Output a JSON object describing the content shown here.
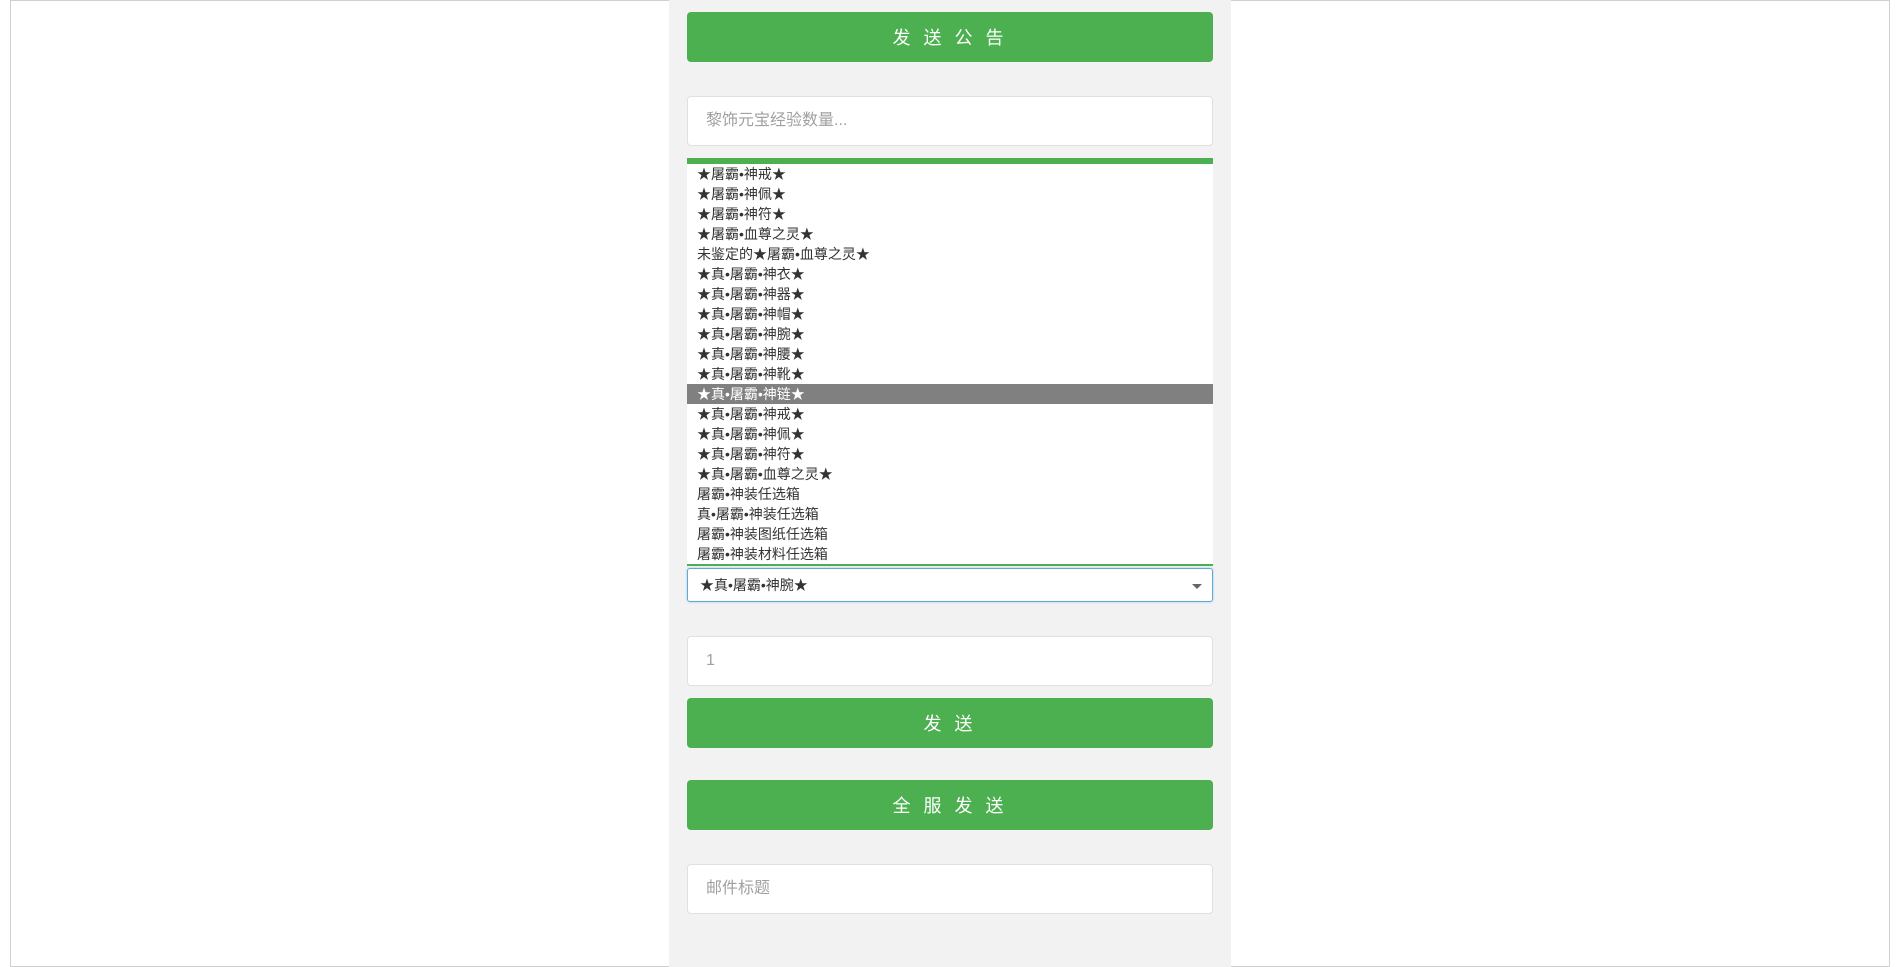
{
  "buttons": {
    "send_notice": "发 送 公 告",
    "send": "发 送",
    "send_all": "全 服 发 送"
  },
  "inputs": {
    "quantity_placeholder": "黎饰元宝经验数量...",
    "count_placeholder": "1",
    "mail_title_placeholder": "邮件标题"
  },
  "select": {
    "selected_value": "★真•屠霸•神腕★",
    "highlighted_index": 11,
    "options": [
      "★屠霸•神戒★",
      "★屠霸•神佩★",
      "★屠霸•神符★",
      "★屠霸•血尊之灵★",
      "未鉴定的★屠霸•血尊之灵★",
      "★真•屠霸•神衣★",
      "★真•屠霸•神器★",
      "★真•屠霸•神帽★",
      "★真•屠霸•神腕★",
      "★真•屠霸•神腰★",
      "★真•屠霸•神靴★",
      "★真•屠霸•神链★",
      "★真•屠霸•神戒★",
      "★真•屠霸•神佩★",
      "★真•屠霸•神符★",
      "★真•屠霸•血尊之灵★",
      "屠霸•神装任选箱",
      "真•屠霸•神装任选箱",
      "屠霸•神装图纸任选箱",
      "屠霸•神装材料任选箱"
    ]
  }
}
